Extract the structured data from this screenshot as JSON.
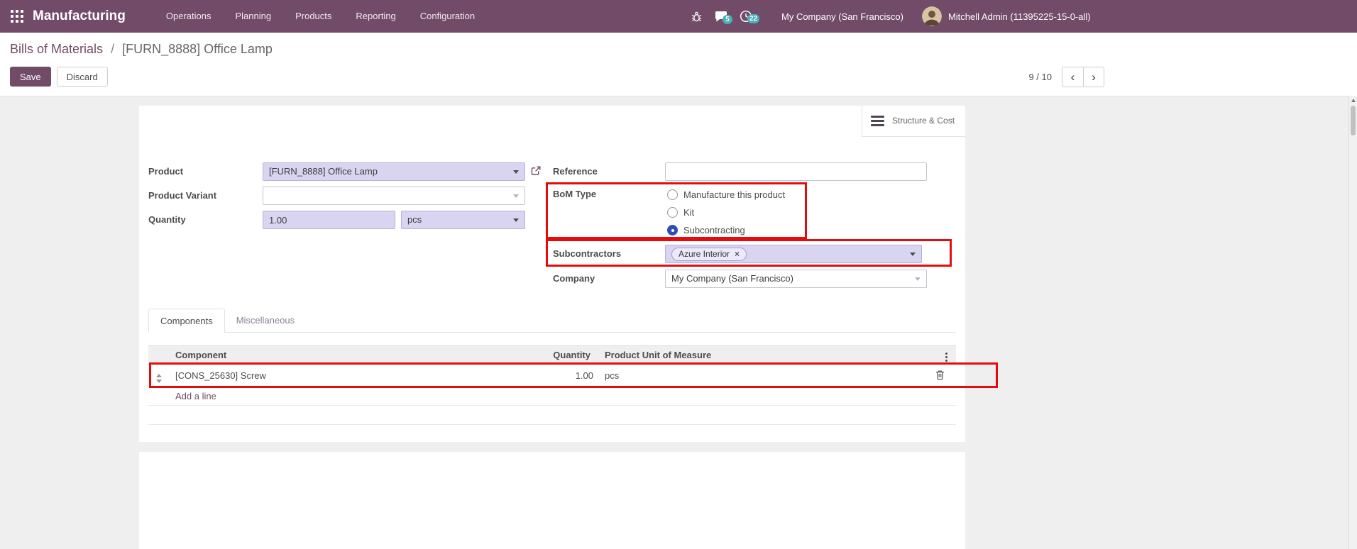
{
  "colors": {
    "navbar_bg": "#714B67",
    "accent": "#714B67",
    "highlight_red": "#e60c0c",
    "required_field_bg": "#D9D5F0",
    "badge_bg": "#49b0b8"
  },
  "navbar": {
    "app_name": "Manufacturing",
    "menus": [
      "Operations",
      "Planning",
      "Products",
      "Reporting",
      "Configuration"
    ],
    "messages_badge": "5",
    "activities_badge": "22",
    "company": "My Company (San Francisco)",
    "user": "Mitchell Admin (11395225-15-0-all)"
  },
  "breadcrumb": {
    "parent": "Bills of Materials",
    "separator": "/",
    "current": "[FURN_8888] Office Lamp"
  },
  "controls": {
    "save": "Save",
    "discard": "Discard",
    "pager": "9 / 10"
  },
  "form": {
    "structure_cost_button": "Structure & Cost",
    "product": {
      "label": "Product",
      "value": "[FURN_8888] Office Lamp"
    },
    "product_variant": {
      "label": "Product Variant",
      "value": ""
    },
    "quantity": {
      "label": "Quantity",
      "value": "1.00",
      "uom": "pcs"
    },
    "reference": {
      "label": "Reference",
      "value": ""
    },
    "bom_type": {
      "label": "BoM Type",
      "options": [
        "Manufacture this product",
        "Kit",
        "Subcontracting"
      ],
      "selected": "Subcontracting"
    },
    "subcontractors": {
      "label": "Subcontractors",
      "tags": [
        "Azure Interior"
      ],
      "remove_glyph": "×"
    },
    "company": {
      "label": "Company",
      "value": "My Company (San Francisco)"
    }
  },
  "tabs": {
    "components": "Components",
    "miscellaneous": "Miscellaneous"
  },
  "components_table": {
    "headers": {
      "component": "Component",
      "quantity": "Quantity",
      "uom": "Product Unit of Measure"
    },
    "rows": [
      {
        "component": "[CONS_25630] Screw",
        "quantity": "1.00",
        "uom": "pcs"
      }
    ],
    "add_line": "Add a line"
  },
  "pager_glyphs": {
    "prev": "‹",
    "next": "›"
  }
}
